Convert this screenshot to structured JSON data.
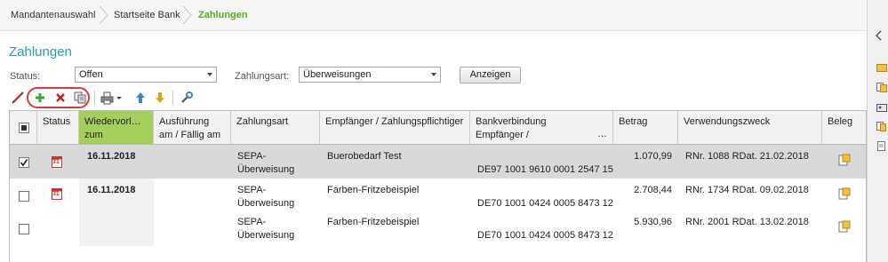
{
  "breadcrumb": {
    "items": [
      "Mandantenauswahl",
      "Startseite Bank",
      "Zahlungen"
    ]
  },
  "page_title": "Zahlungen",
  "filters": {
    "status_label": "Status:",
    "status_value": "Offen",
    "zahlungsart_label": "Zahlungsart:",
    "zahlungsart_value": "Überweisungen",
    "show_button": "Anzeigen"
  },
  "toolbar": {
    "icons": [
      "edit-icon",
      "add-icon",
      "delete-icon",
      "copy-icon",
      "print-icon",
      "move-up-icon",
      "move-down-icon",
      "settings-wrench-icon"
    ]
  },
  "table": {
    "headers": {
      "status": "Status",
      "wiedervorlage_1": "Wiedervorl…",
      "wiedervorlage_2": "zum",
      "ausfuehrung_1": "Ausführung",
      "ausfuehrung_2": "am / Fällig am",
      "zahlungsart": "Zahlungsart",
      "empfaenger": "Empfänger / Zahlungspflichtiger",
      "bank_1": "Bankverbindung",
      "bank_2": "Empfänger /",
      "bank_more": "…",
      "betrag": "Betrag",
      "verwendung": "Verwendungszweck",
      "beleg": "Beleg"
    },
    "rows": [
      {
        "checked": true,
        "selected": true,
        "has_calendar": true,
        "calendar_day": "31",
        "wiedervorlage": "16.11.2018",
        "zahlungsart_1": "SEPA-",
        "zahlungsart_2": "Überweisung",
        "empfaenger": "Buerobedarf Test",
        "iban": "DE97 1001 9610 0001 2547 15",
        "betrag": "1.070,99",
        "verwendung": "RNr. 1088 RDat. 21.02.2018"
      },
      {
        "checked": false,
        "selected": false,
        "has_calendar": true,
        "calendar_day": "31",
        "wiedervorlage": "16.11.2018",
        "zahlungsart_1": "SEPA-",
        "zahlungsart_2": "Überweisung",
        "empfaenger": "Farben-Fritzebeispiel",
        "iban": "DE70 1001 0424 0005 8473 12",
        "betrag": "2.708,44",
        "verwendung": "RNr. 1734 RDat. 09.02.2018"
      },
      {
        "checked": false,
        "selected": false,
        "has_calendar": false,
        "calendar_day": "",
        "wiedervorlage": "",
        "zahlungsart_1": "SEPA-",
        "zahlungsart_2": "Überweisung",
        "empfaenger": "Farben-Fritzebeispiel",
        "iban": "DE70 1001 0424 0005 8473 12",
        "betrag": "5.930,96",
        "verwendung": "RNr. 2001 RDat. 13.02.2018"
      }
    ]
  },
  "colors": {
    "accent_green": "#5aaa1e",
    "title_teal": "#2a9ab0",
    "sorted_header": "#a5cf5a",
    "selected_row": "#d9d9d9",
    "highlight_ring": "#e0373f"
  }
}
